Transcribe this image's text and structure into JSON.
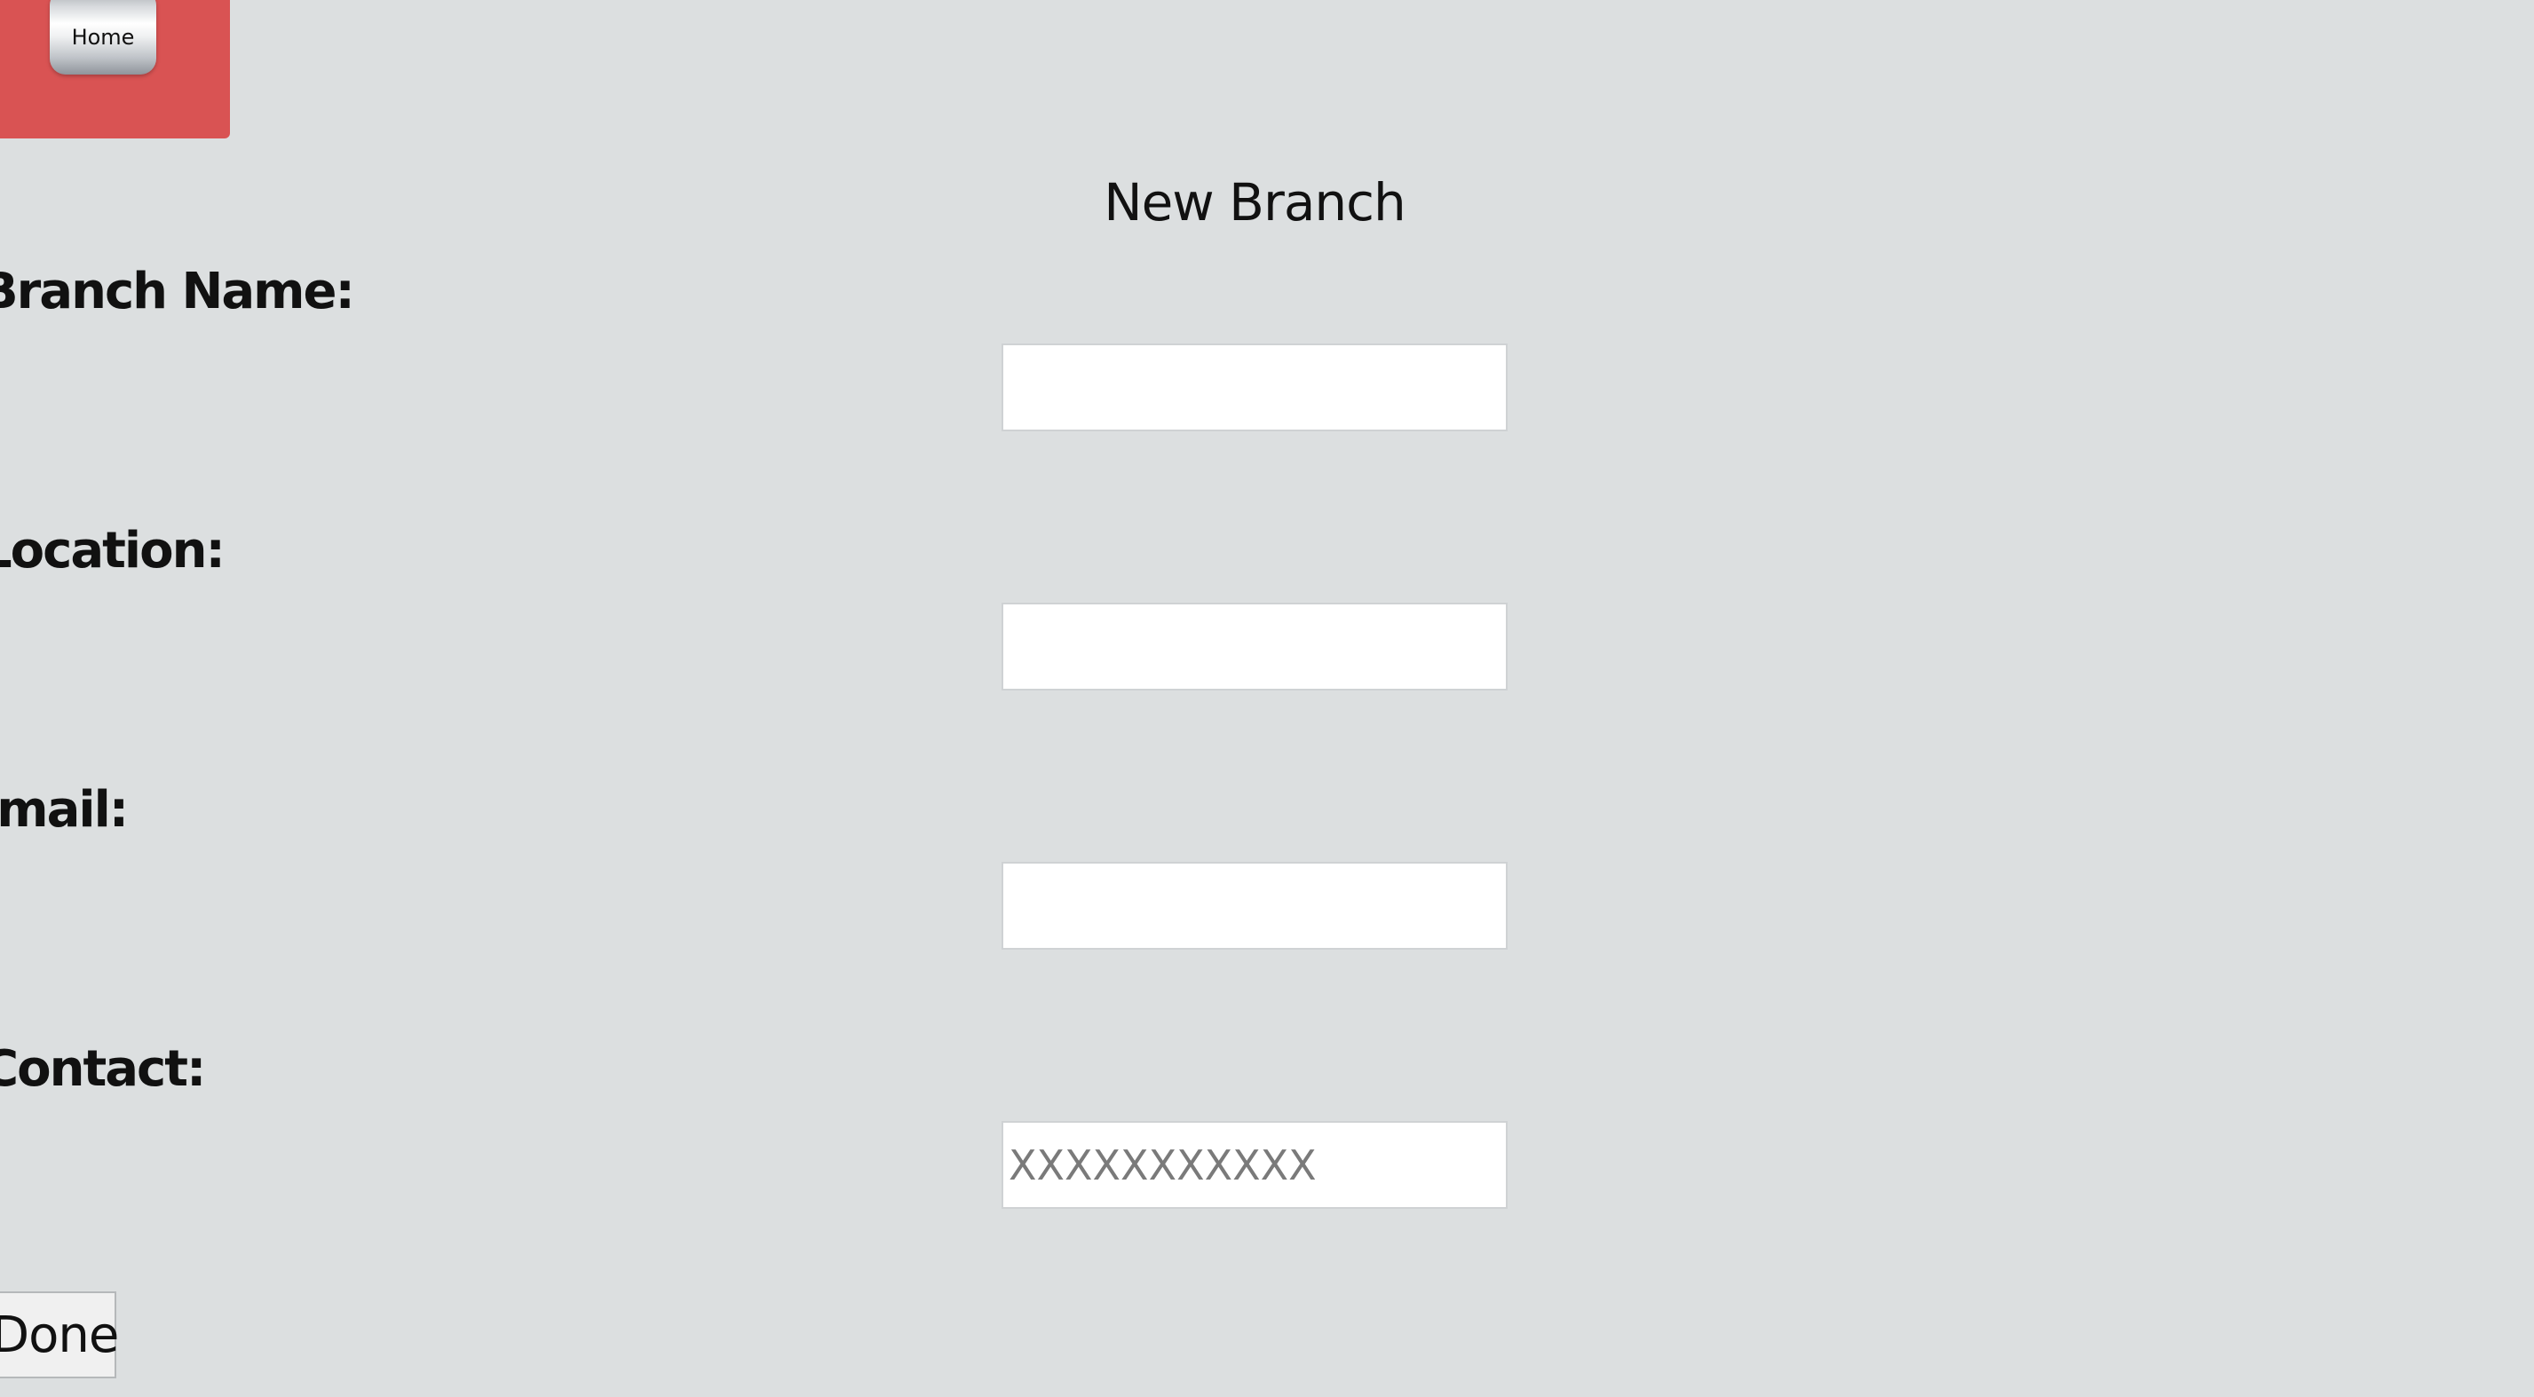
{
  "header": {
    "home_label": "Home",
    "accent_color": "#d95353"
  },
  "form": {
    "title": "New Branch",
    "fields": [
      {
        "label": "Branch Name:",
        "value": "",
        "placeholder": ""
      },
      {
        "label": "Location:",
        "value": "",
        "placeholder": ""
      },
      {
        "label": "Email:",
        "value": "",
        "placeholder": ""
      },
      {
        "label": "Contact:",
        "value": "",
        "placeholder": "XXXXXXXXXXX"
      }
    ],
    "submit_label": "Done"
  }
}
